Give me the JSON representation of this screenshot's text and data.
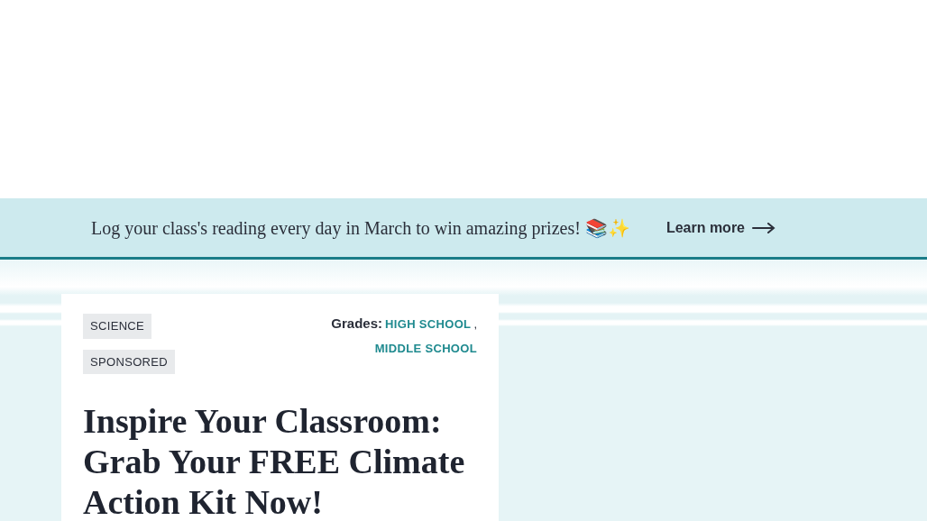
{
  "banner": {
    "message": "Log your class's reading every day in March to win amazing prizes! 📚✨",
    "link": "Learn more"
  },
  "article": {
    "tags": [
      "SCIENCE",
      "SPONSORED"
    ],
    "grades_label": "Grades:",
    "grades": [
      "HIGH SCHOOL",
      "MIDDLE SCHOOL"
    ],
    "grades_separator": ",",
    "title": "Inspire Your Classroom: Grab Your FREE Climate Action Kit Now!"
  }
}
